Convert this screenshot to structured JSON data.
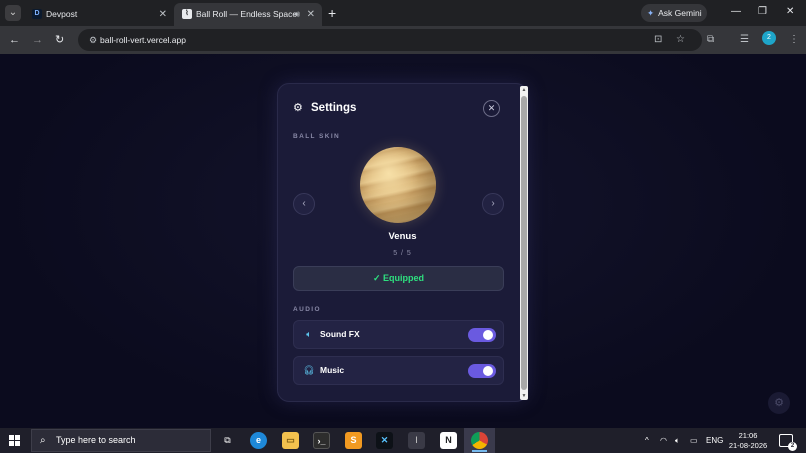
{
  "browser": {
    "tabs": [
      {
        "title": "Devpost",
        "favicon": "D"
      },
      {
        "title": "Ball Roll — Endless Space R",
        "favicon": "⌇"
      }
    ],
    "new_tab_label": "+",
    "gemini_label": "Ask Gemini",
    "url": "ball-roll-vert.vercel.app",
    "profile_initial": "2"
  },
  "settings": {
    "title": "Settings",
    "ball_skin_heading": "BALL SKIN",
    "skin_name": "Venus",
    "skin_index": "5 / 5",
    "equipped_label": "✓ Equipped",
    "audio_heading": "AUDIO",
    "audio_rows": [
      {
        "label": "Sound FX",
        "icon": "speaker-icon",
        "on": true
      },
      {
        "label": "Music",
        "icon": "headphones-icon",
        "on": true
      }
    ]
  },
  "taskbar": {
    "search_placeholder": "Type here to search",
    "language": "ENG",
    "time": "21:06",
    "date": "21-08-2026",
    "notification_count": "2"
  },
  "colors": {
    "accent": "#6a5ae0",
    "equipped_green": "#2ee07f",
    "panel_bg": "#1b1b38",
    "page_bg": "#0b0b1e"
  }
}
